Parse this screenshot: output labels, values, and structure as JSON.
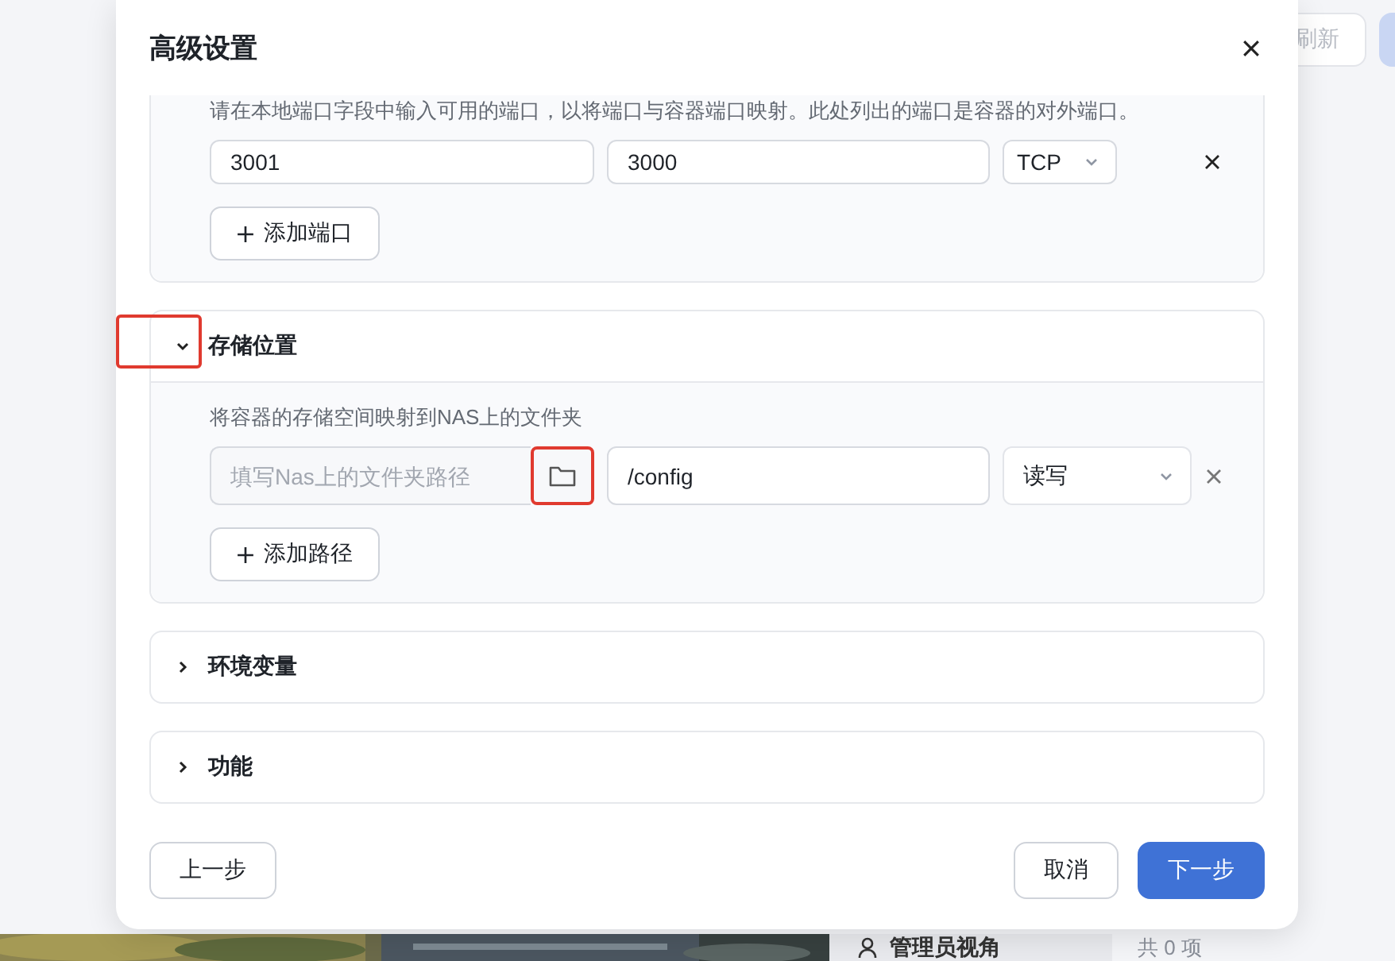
{
  "background": {
    "refresh_button": "刷新",
    "admin_view": "管理员视角",
    "count": "共 0 项"
  },
  "dialog": {
    "title": "高级设置",
    "sections": [
      {
        "kind": "ports",
        "expanded": true,
        "description": "请在本地端口字段中输入可用的端口，以将端口与容器端口映射。此处列出的端口是容器的对外端口。",
        "rows": [
          {
            "local": "3001",
            "container": "3000",
            "protocol": "TCP"
          }
        ],
        "add_button": "添加端口"
      },
      {
        "kind": "storage",
        "title": "存储位置",
        "expanded": true,
        "toggle_highlighted": true,
        "description": "将容器的存储空间映射到NAS上的文件夹",
        "rows": [
          {
            "path_placeholder": "填写Nas上的文件夹路径",
            "browse_highlighted": true,
            "container": "/config",
            "mode": "读写"
          }
        ],
        "add_button": "添加路径"
      },
      {
        "kind": "plain",
        "title": "环境变量",
        "expanded": false,
        "toggle_highlighted": false
      },
      {
        "kind": "plain",
        "title": "功能",
        "expanded": false,
        "toggle_highlighted": false
      }
    ],
    "footer": {
      "back": "上一步",
      "cancel": "取消",
      "next": "下一步"
    }
  }
}
